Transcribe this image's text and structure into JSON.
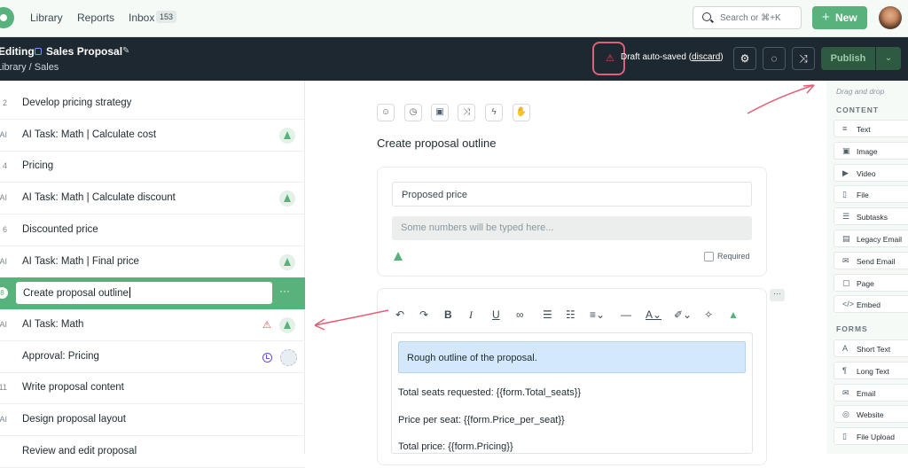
{
  "nav": {
    "library": "Library",
    "reports": "Reports",
    "inbox": "Inbox",
    "inbox_count": "153"
  },
  "search": {
    "placeholder": "Search or ⌘+K"
  },
  "new_button": "New",
  "editbar": {
    "editing": "Editing",
    "title": "Sales Proposal",
    "breadcrumb": "Library  /  Sales",
    "autosave_prefix": "Draft auto-saved (",
    "discard": "discard",
    "autosave_suffix": ")",
    "publish": "Publish"
  },
  "tasks": [
    {
      "num": "2",
      "label": "Develop pricing strategy",
      "ai": false
    },
    {
      "num": "AI",
      "label": "AI Task: Math | Calculate cost",
      "ai": true
    },
    {
      "num": "4",
      "label": "Pricing",
      "ai": false
    },
    {
      "num": "AI",
      "label": "AI Task: Math | Calculate discount",
      "ai": true
    },
    {
      "num": "6",
      "label": "Discounted price",
      "ai": false
    },
    {
      "num": "AI",
      "label": "AI Task: Math | Final price",
      "ai": true
    },
    {
      "num": "8",
      "label": "Create proposal outline",
      "ai": false,
      "selected": true
    },
    {
      "num": "AI",
      "label": "AI Task: Math",
      "ai": true,
      "warning": true
    },
    {
      "num": "",
      "label": "Approval: Pricing",
      "ai": false,
      "approval": true
    },
    {
      "num": "11",
      "label": "Write proposal content",
      "ai": false
    },
    {
      "num": "AI",
      "label": "Design proposal layout",
      "ai": false
    },
    {
      "num": "",
      "label": "Review and edit proposal",
      "ai": false
    }
  ],
  "step": {
    "title": "Create proposal outline",
    "field_value": "Proposed price",
    "field_placeholder": "Some numbers will be typed here...",
    "required_label": "Required",
    "editor_highlight": "Rough outline of the proposal.",
    "editor_lines": [
      "Total seats requested: {{form.Total_seats}}",
      "Price per seat: {{form.Price_per_seat}}",
      "Total price: {{form.Pricing}}"
    ]
  },
  "components": {
    "drag_hint": "Drag and drop",
    "content_title": "CONTENT",
    "content": [
      {
        "icon": "≡",
        "label": "Text"
      },
      {
        "icon": "▣",
        "label": "Image"
      },
      {
        "icon": "▶",
        "label": "Video"
      },
      {
        "icon": "▯",
        "label": "File"
      },
      {
        "icon": "☰",
        "label": "Subtasks"
      },
      {
        "icon": "▤",
        "label": "Legacy Email"
      },
      {
        "icon": "✉",
        "label": "Send Email"
      },
      {
        "icon": "▢",
        "label": "Page"
      },
      {
        "icon": "</>",
        "label": "Embed"
      }
    ],
    "forms_title": "FORMS",
    "forms": [
      {
        "icon": "A",
        "label": "Short Text"
      },
      {
        "icon": "¶",
        "label": "Long Text"
      },
      {
        "icon": "✉",
        "label": "Email"
      },
      {
        "icon": "◎",
        "label": "Website"
      },
      {
        "icon": "▯",
        "label": "File Upload"
      }
    ]
  },
  "colors": {
    "accent": "#58b27c",
    "dark": "#1d2830",
    "annotation": "#e0607a",
    "highlight": "#d4e8fb"
  }
}
